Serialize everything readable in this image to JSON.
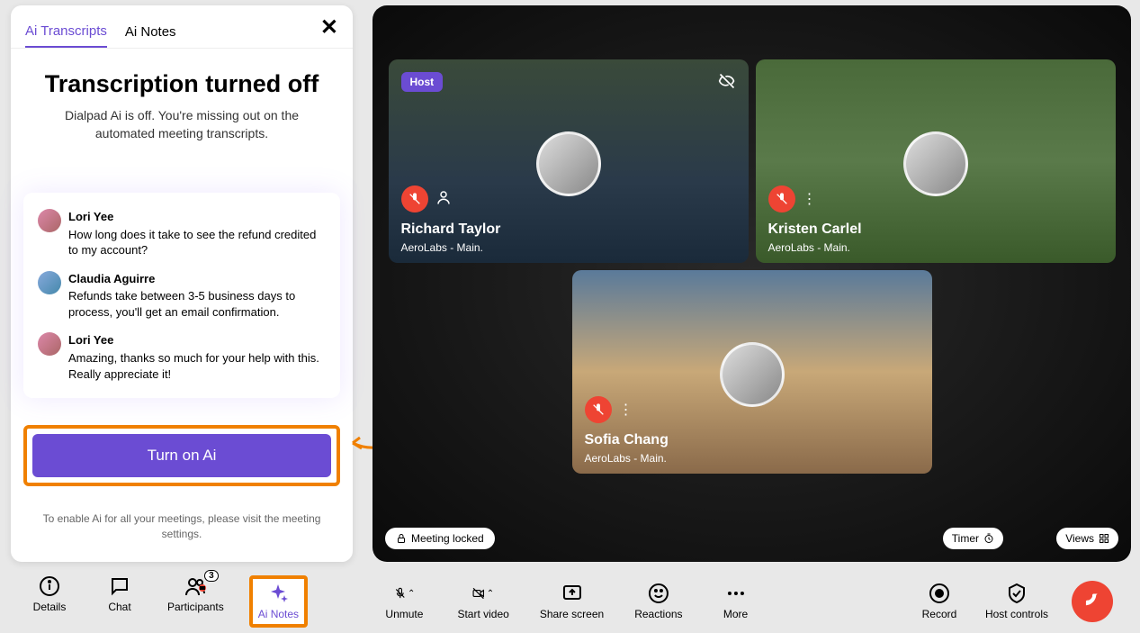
{
  "panel": {
    "tabs": {
      "transcripts": "Ai Transcripts",
      "notes": "Ai Notes"
    },
    "title": "Transcription turned off",
    "subtitle": "Dialpad Ai is off. You're missing out on the automated meeting transcripts.",
    "messages": [
      {
        "name": "Lori Yee",
        "text": "How long does it take to see the refund credited to my account?"
      },
      {
        "name": "Claudia Aguirre",
        "text": "Refunds take between 3-5 business days to process, you'll get an email confirmation."
      },
      {
        "name": "Lori Yee",
        "text": "Amazing, thanks so much for your help with this. Really appreciate it!"
      }
    ],
    "cta": "Turn on Ai",
    "footnote": "To enable Ai for all your meetings, please visit the meeting settings."
  },
  "tiles": [
    {
      "name": "Richard Taylor",
      "loc": "AeroLabs - Main.",
      "host": "Host"
    },
    {
      "name": "Kristen Carlel",
      "loc": "AeroLabs - Main."
    },
    {
      "name": "Sofia Chang",
      "loc": "AeroLabs - Main."
    }
  ],
  "meeting_locked": "Meeting locked",
  "pills": {
    "timer": "Timer",
    "views": "Views"
  },
  "toolbar": {
    "details": "Details",
    "chat": "Chat",
    "participants": "Participants",
    "participants_count": "3",
    "ainotes": "Ai Notes",
    "unmute": "Unmute",
    "startvideo": "Start video",
    "sharescreen": "Share screen",
    "reactions": "Reactions",
    "more": "More",
    "record": "Record",
    "hostcontrols": "Host controls"
  }
}
